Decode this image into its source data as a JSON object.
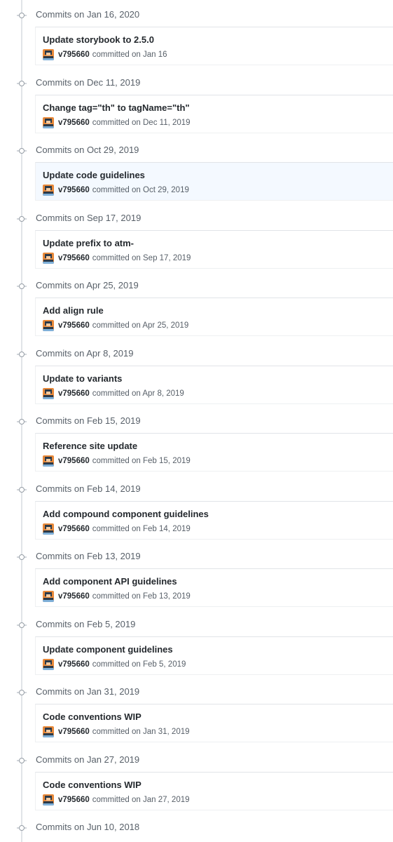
{
  "commit_groups": [
    {
      "date_label": "Commits on Jan 16, 2020",
      "title": "Update storybook to 2.5.0",
      "author": "v795660",
      "committed_text": "committed on Jan 16",
      "highlighted": false
    },
    {
      "date_label": "Commits on Dec 11, 2019",
      "title": "Change tag=\"th\" to tagName=\"th\"",
      "author": "v795660",
      "committed_text": "committed on Dec 11, 2019",
      "highlighted": false
    },
    {
      "date_label": "Commits on Oct 29, 2019",
      "title": "Update code guidelines",
      "author": "v795660",
      "committed_text": "committed on Oct 29, 2019",
      "highlighted": true
    },
    {
      "date_label": "Commits on Sep 17, 2019",
      "title": "Update prefix to atm-",
      "author": "v795660",
      "committed_text": "committed on Sep 17, 2019",
      "highlighted": false
    },
    {
      "date_label": "Commits on Apr 25, 2019",
      "title": "Add align rule",
      "author": "v795660",
      "committed_text": "committed on Apr 25, 2019",
      "highlighted": false
    },
    {
      "date_label": "Commits on Apr 8, 2019",
      "title": "Update to variants",
      "author": "v795660",
      "committed_text": "committed on Apr 8, 2019",
      "highlighted": false
    },
    {
      "date_label": "Commits on Feb 15, 2019",
      "title": "Reference site update",
      "author": "v795660",
      "committed_text": "committed on Feb 15, 2019",
      "highlighted": false
    },
    {
      "date_label": "Commits on Feb 14, 2019",
      "title": "Add compound component guidelines",
      "author": "v795660",
      "committed_text": "committed on Feb 14, 2019",
      "highlighted": false
    },
    {
      "date_label": "Commits on Feb 13, 2019",
      "title": "Add component API guidelines",
      "author": "v795660",
      "committed_text": "committed on Feb 13, 2019",
      "highlighted": false
    },
    {
      "date_label": "Commits on Feb 5, 2019",
      "title": "Update component guidelines",
      "author": "v795660",
      "committed_text": "committed on Feb 5, 2019",
      "highlighted": false
    },
    {
      "date_label": "Commits on Jan 31, 2019",
      "title": "Code conventions WIP",
      "author": "v795660",
      "committed_text": "committed on Jan 31, 2019",
      "highlighted": false
    },
    {
      "date_label": "Commits on Jan 27, 2019",
      "title": "Code conventions WIP",
      "author": "v795660",
      "committed_text": "committed on Jan 27, 2019",
      "highlighted": false
    },
    {
      "date_label": "Commits on Jun 10, 2018",
      "title": "",
      "author": "",
      "committed_text": "",
      "highlighted": false
    }
  ],
  "colors": {
    "text": "#24292e",
    "muted": "#586069",
    "border": "#e1e4e8",
    "highlight_bg": "#f4f9ff",
    "avatar_orange": "#e8893a",
    "avatar_dark": "#2b3a4a",
    "avatar_blue": "#7fb0d9"
  },
  "icons": {
    "timeline_node": "git-commit-icon",
    "avatar": "user-avatar-icon"
  }
}
